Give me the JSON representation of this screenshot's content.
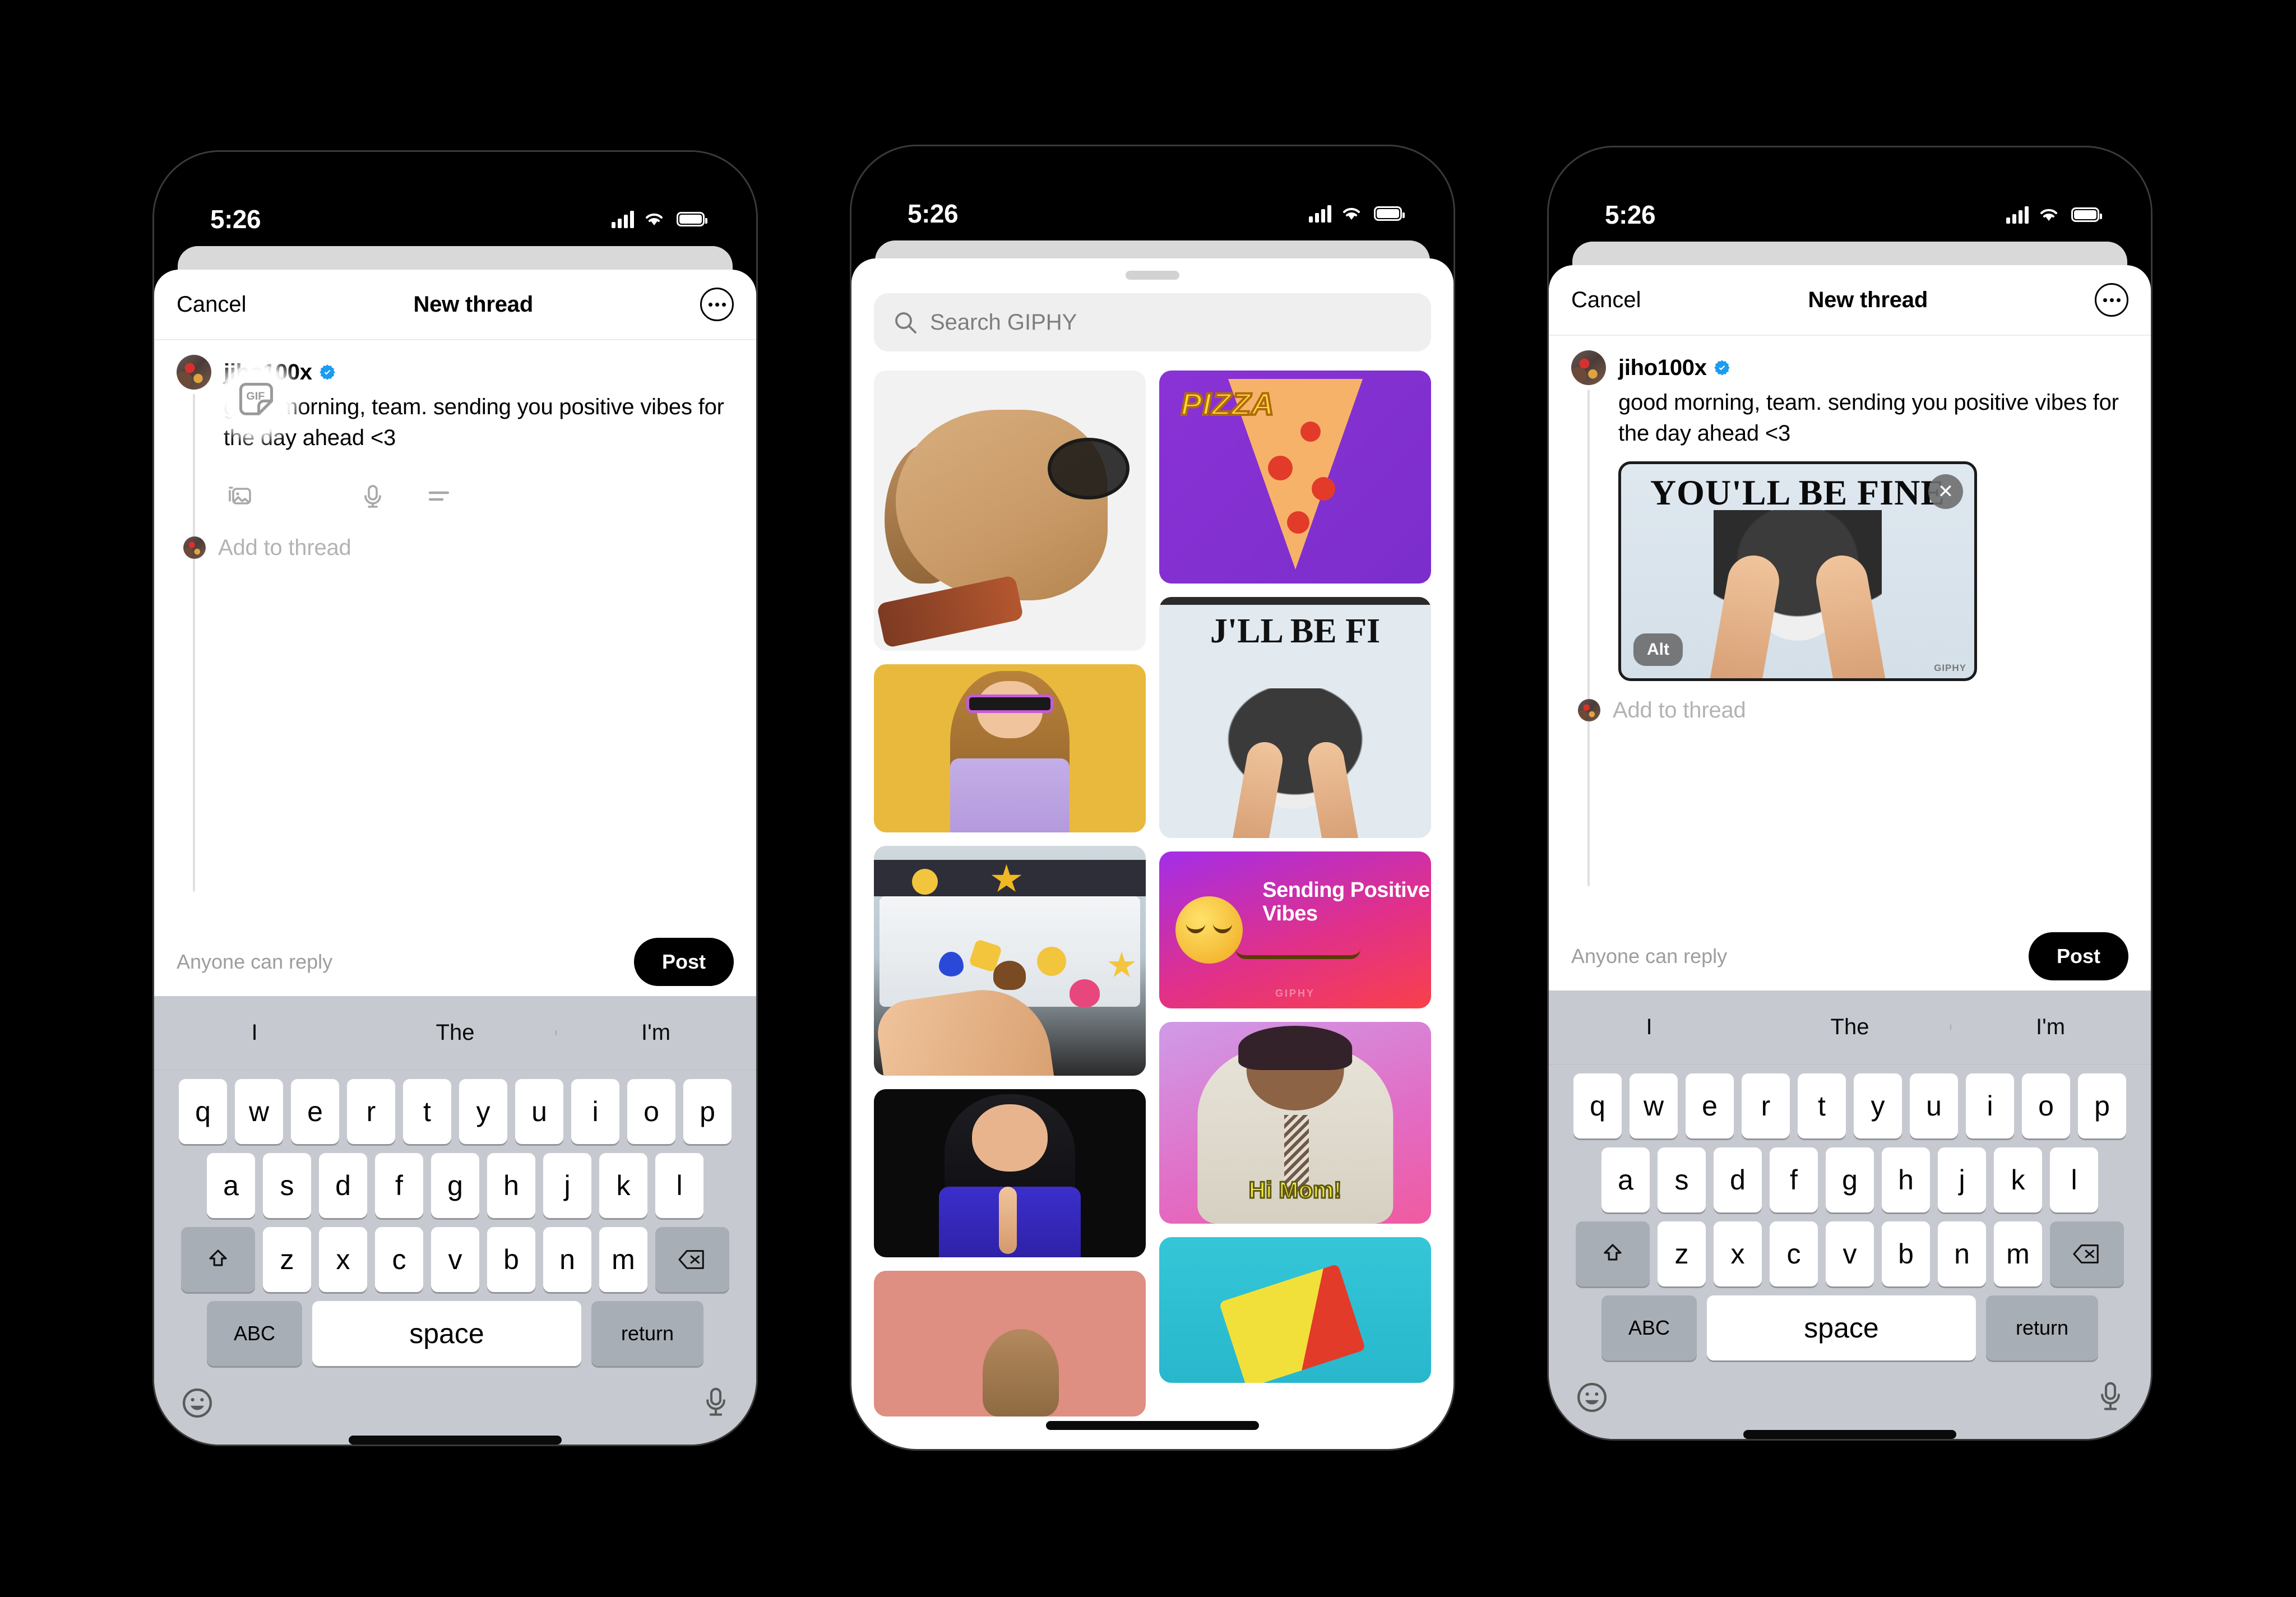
{
  "statusbar": {
    "time": "5:26"
  },
  "compose": {
    "nav": {
      "cancel": "Cancel",
      "title": "New thread",
      "more_icon": "more-options-icon"
    },
    "author": {
      "username": "jiho100x",
      "verified": true
    },
    "post_text": "good morning, team. sending you positive vibes for the day ahead <3",
    "tools": [
      {
        "name": "media-icon",
        "label": "Media"
      },
      {
        "name": "gif-icon",
        "label": "GIF"
      },
      {
        "name": "microphone-icon",
        "label": "Voice"
      },
      {
        "name": "text-format-icon",
        "label": "Text"
      }
    ],
    "gif_label": "GIF",
    "add_to_thread": "Add to thread",
    "reply_setting": "Anyone can reply",
    "post_button": "Post",
    "attachment": {
      "meme_text": "YOU'LL BE FINE",
      "alt_badge": "Alt",
      "remove_label": "✕",
      "watermark": "GIPHY"
    }
  },
  "giphy": {
    "search_placeholder": "Search GIPHY",
    "search_icon": "search-icon",
    "grabber": "sheet-grabber",
    "items_left": [
      {
        "id": "dog-glasses",
        "caption": ""
      },
      {
        "id": "girl-sunglasses",
        "caption": ""
      },
      {
        "id": "emoji-keyboard",
        "caption": ""
      },
      {
        "id": "woman-praying",
        "caption": ""
      },
      {
        "id": "peach-kid",
        "caption": ""
      }
    ],
    "items_right": [
      {
        "id": "pizza-slice",
        "caption": "PIZZA"
      },
      {
        "id": "pomeranian-fine",
        "caption": "J'LL BE FI"
      },
      {
        "id": "sending-positive-vibes",
        "caption": "Sending Positive Vibes",
        "watermark": "GIPHY"
      },
      {
        "id": "hi-mom",
        "caption": "Hi Mom!"
      },
      {
        "id": "teal-popsicle",
        "caption": ""
      }
    ]
  },
  "keyboard": {
    "predictions": [
      "I",
      "The",
      "I'm"
    ],
    "row1": [
      "q",
      "w",
      "e",
      "r",
      "t",
      "y",
      "u",
      "i",
      "o",
      "p"
    ],
    "row2": [
      "a",
      "s",
      "d",
      "f",
      "g",
      "h",
      "j",
      "k",
      "l"
    ],
    "row3": [
      "z",
      "x",
      "c",
      "v",
      "b",
      "n",
      "m"
    ],
    "shift_icon": "shift-icon",
    "delete_icon": "backspace-icon",
    "abc_key": "ABC",
    "space_key": "space",
    "return_key": "return",
    "emoji_icon": "emoji-icon",
    "dictation_icon": "microphone-icon"
  },
  "colors": {
    "accent": "#000000",
    "verified": "#1d9bf0",
    "keyboard_bg": "#c6cad0",
    "key_bg": "#ffffff",
    "modifier_key_bg": "#a8aeb6",
    "placeholder": "#7d7d7d"
  }
}
